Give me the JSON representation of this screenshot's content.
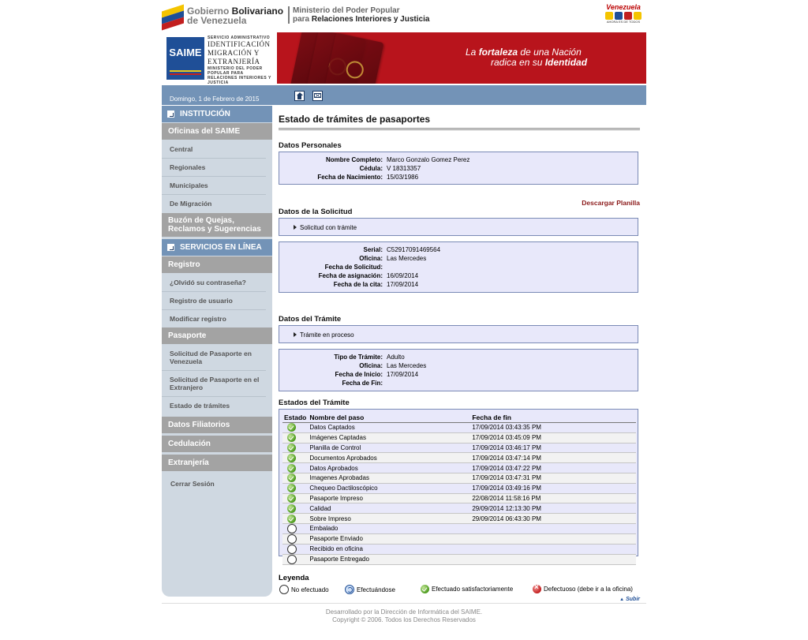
{
  "header": {
    "gov_line1_a": "Gobierno ",
    "gov_line1_b": "Bolivariano",
    "gov_line2": "de Venezuela",
    "ministry_line1": "Ministerio del Poder Popular",
    "ministry_line2_a": "para ",
    "ministry_line2_b": "Relaciones Interiores y Justicia",
    "vzla_logo": "Venezuela",
    "vzla_sub": "AHORA ES DE TODOS"
  },
  "banner": {
    "saime": "SAIME",
    "saime_line1": "SERVICIO ADMINISTRATIVO",
    "saime_line2": "IDENTIFICACIÓN",
    "saime_line3": "MIGRACIÓN Y",
    "saime_line4": "EXTRANJERÍA",
    "saime_small": "MINISTERIO DEL PODER POPULAR PARA RELACIONES INTERIORES Y JUSTICIA",
    "slogan_a": "La ",
    "slogan_b": "fortaleza",
    "slogan_c": " de una Nación",
    "slogan_d": "radica en su ",
    "slogan_e": "Identidad"
  },
  "datebar": {
    "date": "Domingo, 1 de Febrero de 2015"
  },
  "sidebar": {
    "institucion": "INSTITUCIÓN",
    "oficinas": "Oficinas del SAIME",
    "oficinas_items": [
      "Central",
      "Regionales",
      "Municipales",
      "De Migración"
    ],
    "buzon": "Buzón de Quejas, Reclamos y Sugerencias",
    "servicios": "SERVICIOS EN LÍNEA",
    "registro": "Registro",
    "registro_items": [
      "¿Olvidó su contraseña?",
      "Registro de usuario",
      "Modificar registro"
    ],
    "pasaporte": "Pasaporte",
    "pasaporte_items": [
      "Solicitud de Pasaporte en Venezuela",
      "Solicitud de Pasaporte en el Extranjero",
      "Estado de trámites"
    ],
    "filiatorios": "Datos Filiatorios",
    "cedulacion": "Cedulación",
    "extranjeria": "Extranjería",
    "cerrar": "Cerrar Sesión"
  },
  "main": {
    "title": "Estado de trámites de pasaportes",
    "personal_heading": "Datos Personales",
    "personal": [
      {
        "k": "Nombre Completo:",
        "v": "Marco Gonzalo Gomez Perez"
      },
      {
        "k": "Cédula:",
        "v": "V 18313357"
      },
      {
        "k": "Fecha de Nacimiento:",
        "v": "15/03/1986"
      }
    ],
    "download": "Descargar Planilla",
    "solicitud_heading": "Datos de la Solicitud",
    "solicitud_status": "Solicitud con trámite",
    "solicitud": [
      {
        "k": "Serial:",
        "v": "C52917091469564"
      },
      {
        "k": "Oficina:",
        "v": "Las Mercedes"
      },
      {
        "k": "Fecha de Solicitud:",
        "v": ""
      },
      {
        "k": "Fecha de asignación:",
        "v": "16/09/2014"
      },
      {
        "k": "Fecha de la cita:",
        "v": "17/09/2014"
      }
    ],
    "tramite_heading": "Datos del Trámite",
    "tramite_status": "Trámite en proceso",
    "tramite": [
      {
        "k": "Tipo de Trámite:",
        "v": "Adulto"
      },
      {
        "k": "Oficina:",
        "v": "Las Mercedes"
      },
      {
        "k": "Fecha de Inicio:",
        "v": "17/09/2014"
      },
      {
        "k": "Fecha de Fin:",
        "v": ""
      }
    ],
    "estados_heading": "Estados del Trámite",
    "cols": [
      "Estado",
      "Nombre del paso",
      "Fecha de fin"
    ],
    "steps": [
      {
        "status": "ok",
        "name": "Datos Captados",
        "date": "17/09/2014 03:43:35 PM"
      },
      {
        "status": "ok",
        "name": "Imágenes Captadas",
        "date": "17/09/2014 03:45:09 PM"
      },
      {
        "status": "ok",
        "name": "Planilla de Control",
        "date": "17/09/2014 03:46:17 PM"
      },
      {
        "status": "ok",
        "name": "Documentos Aprobados",
        "date": "17/09/2014 03:47:14 PM"
      },
      {
        "status": "ok",
        "name": "Datos Aprobados",
        "date": "17/09/2014 03:47:22 PM"
      },
      {
        "status": "ok",
        "name": "Imagenes Aprobadas",
        "date": "17/09/2014 03:47:31 PM"
      },
      {
        "status": "ok",
        "name": "Chequeo Dactiloscópico",
        "date": "17/09/2014 03:49:16 PM"
      },
      {
        "status": "ok",
        "name": "Pasaporte Impreso",
        "date": "22/08/2014 11:58:16 PM"
      },
      {
        "status": "ok",
        "name": "Calidad",
        "date": "29/09/2014 12:13:30 PM"
      },
      {
        "status": "ok",
        "name": "Sobre Impreso",
        "date": "29/09/2014 06:43:30 PM"
      },
      {
        "status": "none",
        "name": "Embalado",
        "date": ""
      },
      {
        "status": "none",
        "name": "Pasaporte Enviado",
        "date": ""
      },
      {
        "status": "none",
        "name": "Recibido en oficina",
        "date": ""
      },
      {
        "status": "none",
        "name": "Pasaporte Entregado",
        "date": ""
      }
    ],
    "legend_heading": "Leyenda",
    "legend": [
      "No efectuado",
      "Efectuándose",
      "Efectuado satisfactoriamente",
      "Defectuoso (debe ir a la oficina)"
    ],
    "up": "Subir"
  },
  "footer": {
    "line1": "Desarrollado por la Dirección de Informática del SAIME.",
    "line2": "Copyright © 2006. Todos los Derechos Reservados"
  }
}
